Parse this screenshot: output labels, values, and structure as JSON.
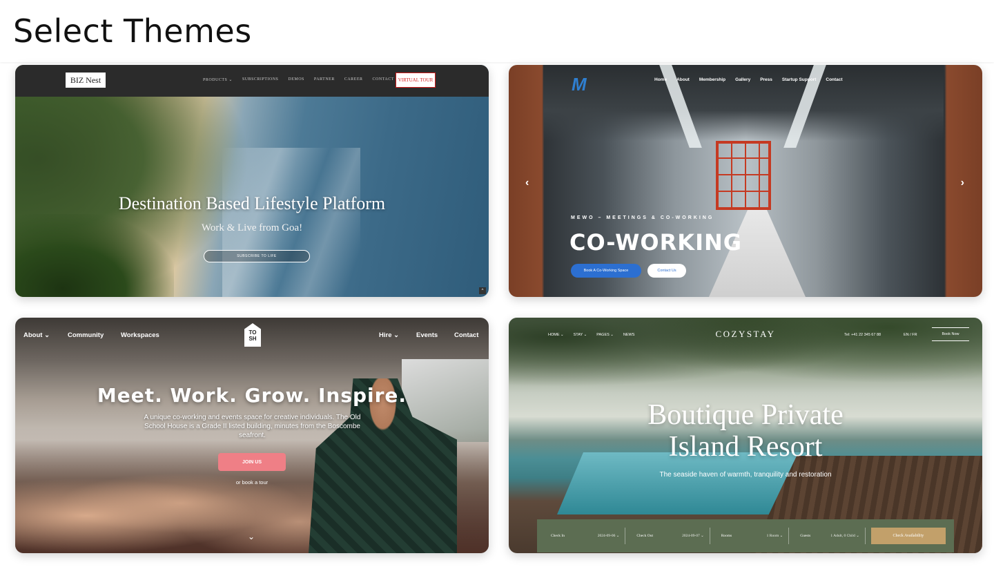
{
  "page": {
    "title": "Select Themes"
  },
  "themes": [
    {
      "logo": "BIZ Nest",
      "nav": [
        "PRODUCTS ⌄",
        "SUBSCRIPTIONS",
        "DEMOS",
        "PARTNER",
        "CAREER",
        "CONTACT"
      ],
      "cta_nav": "VIRTUAL TOUR",
      "headline": "Destination Based Lifestyle Platform",
      "subheadline": "Work & Live from Goa!",
      "button": "SUBSCRIBE TO LIFE"
    },
    {
      "logo": "M",
      "nav": [
        "Home",
        "About",
        "Membership",
        "Gallery",
        "Press",
        "Startup Support",
        "Contact"
      ],
      "kicker": "MEWO – MEETINGS & CO-WORKING",
      "headline": "CO-WORKING",
      "button_primary": "Book A Co-Working Space",
      "button_secondary": "Contact Us",
      "prev_arrow": "‹",
      "next_arrow": "›"
    },
    {
      "nav_left": [
        "About ⌄",
        "Community",
        "Workspaces"
      ],
      "nav_right": [
        "Hire ⌄",
        "Events",
        "Contact"
      ],
      "logo": "TO SH",
      "headline": "Meet. Work. Grow. Inspire.",
      "subheadline": "A unique co-working and events space for creative individuals. The Old School House is a Grade II listed building, minutes from the Boscombe seafront.",
      "button": "JOIN US",
      "secondary_link": "or book a tour",
      "scroll_chevron": "⌄"
    },
    {
      "nav": [
        "HOME ⌄",
        "STAY ⌄",
        "PAGES ⌄",
        "NEWS"
      ],
      "brand": "COZYSTAY",
      "phone": "Tel: +41 22 345 67 88",
      "language": "EN / FR",
      "book_button": "Book Now",
      "headline_line1": "Boutique Private",
      "headline_line2": "Island Resort",
      "subheadline": "The seaside haven of warmth, tranquility and restoration",
      "booking": {
        "check_in_label": "Check In",
        "check_in_value": "2024-09-06 ⌄",
        "check_out_label": "Check Out",
        "check_out_value": "2024-09-07 ⌄",
        "rooms_label": "Rooms",
        "rooms_value": "1 Room ⌄",
        "guests_label": "Guests",
        "guests_value": "1 Adult, 0 Child ⌄",
        "submit": "Check Availability"
      }
    }
  ]
}
